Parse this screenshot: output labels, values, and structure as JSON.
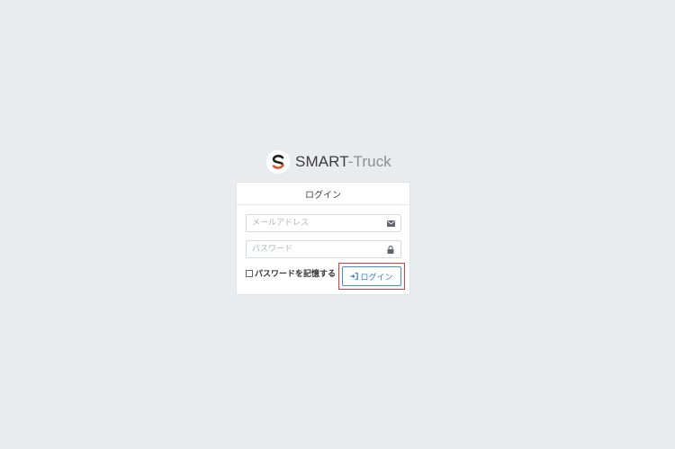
{
  "brand": {
    "name_primary": "SMART",
    "name_secondary": "-Truck",
    "logo_icon": "s-logo-icon",
    "colors": {
      "logo_black": "#1f1f1f",
      "logo_orange": "#e2552a"
    }
  },
  "card": {
    "title": "ログイン"
  },
  "form": {
    "email": {
      "placeholder": "メールアドレス",
      "value": "",
      "icon": "envelope-icon"
    },
    "password": {
      "placeholder": "パスワード",
      "value": "",
      "icon": "lock-icon"
    },
    "remember_label": "パスワードを記憶する",
    "remember_checked": false,
    "submit_label": "ログイン",
    "submit_icon": "sign-in-icon"
  },
  "colors": {
    "background": "#e9ecef",
    "accent": "#3d8fe0",
    "highlight": "#e23b3b"
  }
}
